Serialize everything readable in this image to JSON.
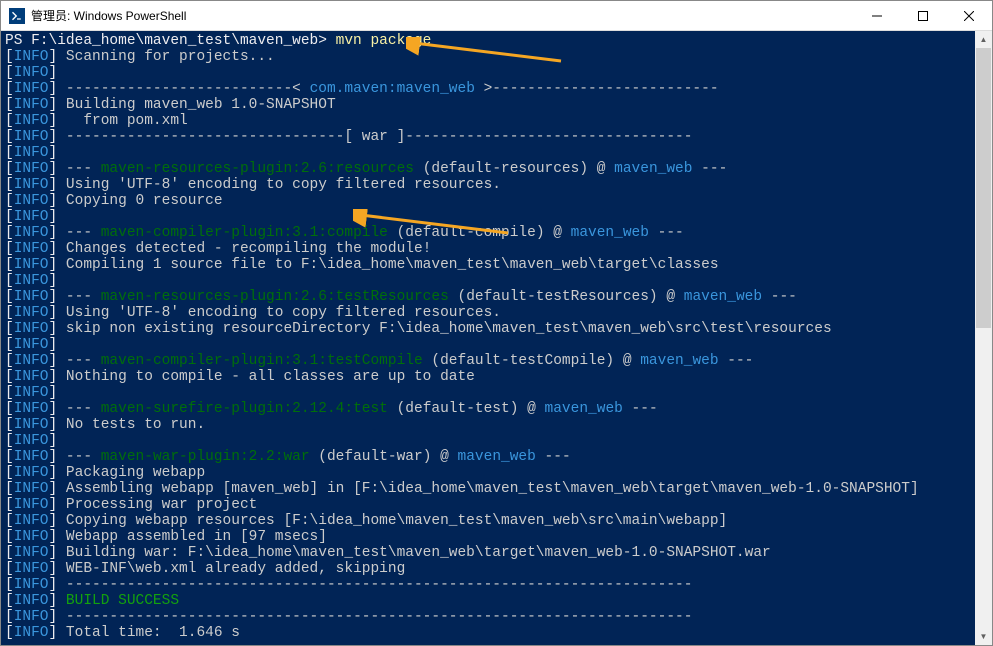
{
  "window": {
    "title": "管理员: Windows PowerShell"
  },
  "prompt": "PS F:\\idea_home\\maven_test\\maven_web>",
  "command": "mvn package",
  "info_tag_open": "[",
  "info_tag_word": "INFO",
  "info_tag_close": "]",
  "lines": {
    "scan": " Scanning for projects...",
    "blank": "",
    "dash_proj_open": " --------------------------< ",
    "proj_name": "com.maven:maven_web",
    "dash_proj_close": " >--------------------------",
    "building": " Building maven_web 1.0-SNAPSHOT",
    "from_pom": "   from pom.xml",
    "war_line": " --------------------------------[ war ]---------------------------------",
    "plugin_prefix": " --- ",
    "res_plugin": "maven-resources-plugin:2.6:resources",
    "res_suffix": " (default-resources) @ ",
    "proj": "maven_web",
    "dash_end": " ---",
    "utf8": " Using 'UTF-8' encoding to copy filtered resources.",
    "copy0": " Copying 0 resource",
    "compile_plugin": "maven-compiler-plugin:3.1:compile",
    "compile_suffix": " (default-compile) @ ",
    "changes": " Changes detected - recompiling the module!",
    "compiling": " Compiling 1 source file to F:\\idea_home\\maven_test\\maven_web\\target\\classes",
    "testres_plugin": "maven-resources-plugin:2.6:testResources",
    "testres_suffix": " (default-testResources) @ ",
    "skip_nonexist": " skip non existing resourceDirectory F:\\idea_home\\maven_test\\maven_web\\src\\test\\resources",
    "testcompile_plugin": "maven-compiler-plugin:3.1:testCompile",
    "testcompile_suffix": " (default-testCompile) @ ",
    "nothing_compile": " Nothing to compile - all classes are up to date",
    "surefire_plugin": "maven-surefire-plugin:2.12.4:test",
    "surefire_suffix": " (default-test) @ ",
    "no_tests": " No tests to run.",
    "war_plugin": "maven-war-plugin:2.2:war",
    "war_suffix": " (default-war) @ ",
    "packaging": " Packaging webapp",
    "assembling": " Assembling webapp [maven_web] in [F:\\idea_home\\maven_test\\maven_web\\target\\maven_web-1.0-SNAPSHOT]",
    "processing": " Processing war project",
    "copying_webapp": " Copying webapp resources [F:\\idea_home\\maven_test\\maven_web\\src\\main\\webapp]",
    "webapp_assembled": " Webapp assembled in [97 msecs]",
    "building_war": " Building war: F:\\idea_home\\maven_test\\maven_web\\target\\maven_web-1.0-SNAPSHOT.war",
    "webinf": " WEB-INF\\web.xml already added, skipping",
    "hr": " ------------------------------------------------------------------------",
    "build_success": " BUILD SUCCESS",
    "total_time": " Total time:  1.646 s"
  }
}
